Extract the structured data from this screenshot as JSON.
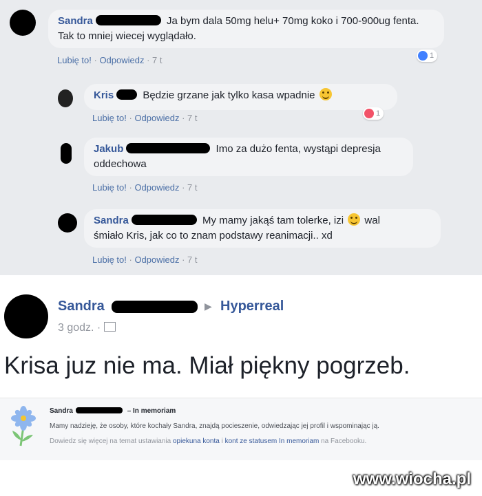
{
  "comments": [
    {
      "name": "Sandra",
      "text": "Ja bym dala 50mg helu+ 70mg koko i 700-900ug fenta. Tak to mniej wiecej wyglądało.",
      "like": "Lubię to!",
      "reply": "Odpowiedz",
      "time": "7 t",
      "reaction_count": "1"
    },
    {
      "name": "Kris",
      "text": "Będzie grzane jak tylko kasa wpadnie",
      "like": "Lubię to!",
      "reply": "Odpowiedz",
      "time": "7 t",
      "reaction_count": "1"
    },
    {
      "name": "Jakub",
      "text_line1": "Imo za dużo fenta, wystąpi depresja",
      "text_line2": "oddechowa",
      "like": "Lubię to!",
      "reply": "Odpowiedz",
      "time": "7 t"
    },
    {
      "name": "Sandra",
      "text_part1": "My mamy jakąś tam tolerke, izi",
      "text_part2": "wal",
      "text_line2": "śmiało Kris, jak co to znam podstawy reanimacji.. xd",
      "like": "Lubię to!",
      "reply": "Odpowiedz",
      "time": "7 t"
    }
  ],
  "post": {
    "name": "Sandra",
    "group": "Hyperreal",
    "time": "3 godz. ·",
    "text": "Krisa juz nie ma. Miał piękny pogrzeb."
  },
  "memorial": {
    "name": "Sandra",
    "title_suffix": "– In memoriam",
    "body": "Mamy nadzieję, że osoby, które kochały Sandra, znajdą pocieszenie, odwiedzając jej profil i wspominając ją.",
    "help_prefix": "Dowiedz się więcej na temat ustawiania",
    "help_link1": "opiekuna konta",
    "help_mid": "i",
    "help_link2": "kont ze statusem In memoriam",
    "help_suffix": "na Facebooku."
  },
  "watermark": "www.wiocha.pl",
  "colors": {
    "link": "#365899",
    "bubble": "#f2f3f5",
    "like_blue": "#4080ff",
    "love_red": "#f25268"
  }
}
